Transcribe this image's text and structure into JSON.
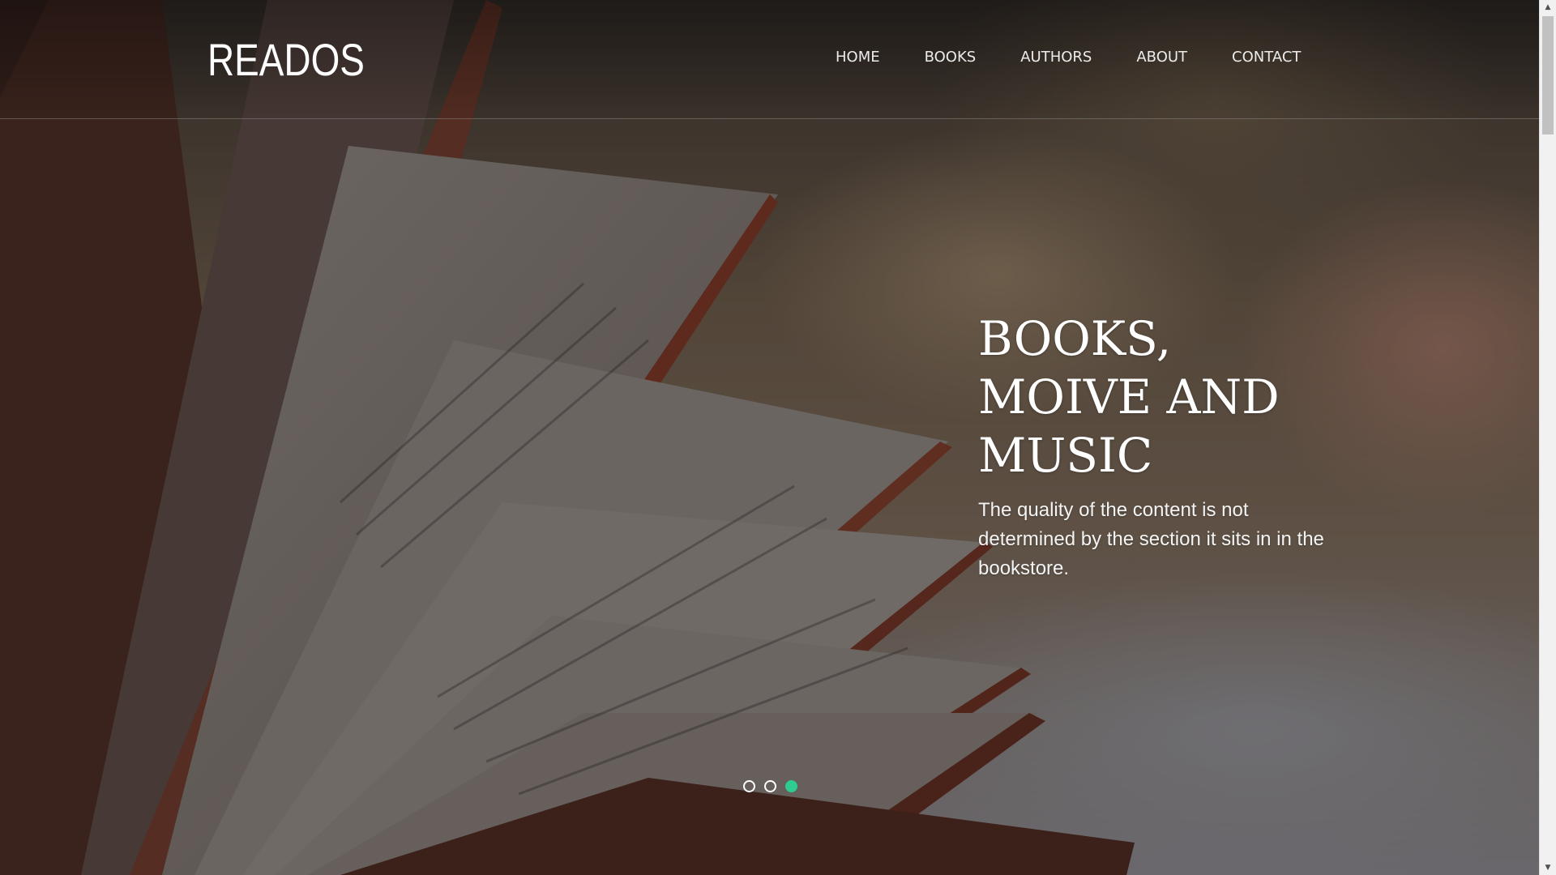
{
  "header": {
    "logo": "READOS",
    "nav": [
      {
        "label": "HOME"
      },
      {
        "label": "BOOKS"
      },
      {
        "label": "AUTHORS"
      },
      {
        "label": "ABOUT"
      },
      {
        "label": "CONTACT"
      }
    ]
  },
  "hero": {
    "background_image": "open-book-photo",
    "title": "BOOKS, MOIVE AND MUSIC",
    "subtitle": "The quality of the content is not determined by the section it sits in in the bookstore.",
    "slider": {
      "total": 3,
      "active_index": 3,
      "dots": [
        "slide-1",
        "slide-2",
        "slide-3"
      ]
    }
  },
  "colors": {
    "accent": "#2ecc8f",
    "text": "#ffffff"
  },
  "scrollbar": {
    "up_icon": "chevron-up-icon",
    "down_icon": "chevron-down-icon",
    "up_glyph": "▲",
    "down_glyph": "▼"
  }
}
